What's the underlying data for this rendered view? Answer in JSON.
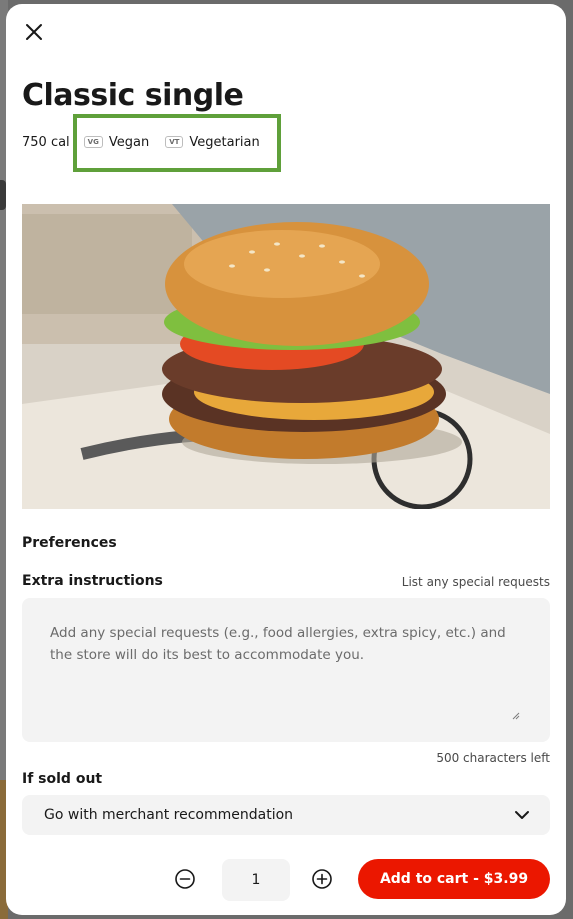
{
  "item": {
    "title": "Classic single",
    "calories": "750 cal",
    "tags": [
      {
        "badge": "VG",
        "label": "Vegan"
      },
      {
        "badge": "VT",
        "label": "Vegetarian"
      }
    ],
    "image_alt": "Classic single burger"
  },
  "preferences": {
    "heading": "Preferences",
    "extra_instructions": {
      "label": "Extra instructions",
      "hint": "List any special requests",
      "placeholder": "Add any special requests (e.g., food allergies, extra spicy, etc.) and the store will do its best to accommodate you.",
      "chars_left": "500 characters left"
    },
    "sold_out": {
      "label": "If sold out",
      "selected": "Go with merchant recommendation"
    }
  },
  "footer": {
    "quantity": "1",
    "add_to_cart": "Add to cart - $3.99"
  },
  "colors": {
    "accent": "#eb1700",
    "highlight": "#5fa03a"
  },
  "icons": {
    "close": "close-icon",
    "chevron": "chevron-down-icon",
    "minus": "minus-circle-icon",
    "plus": "plus-circle-icon"
  }
}
